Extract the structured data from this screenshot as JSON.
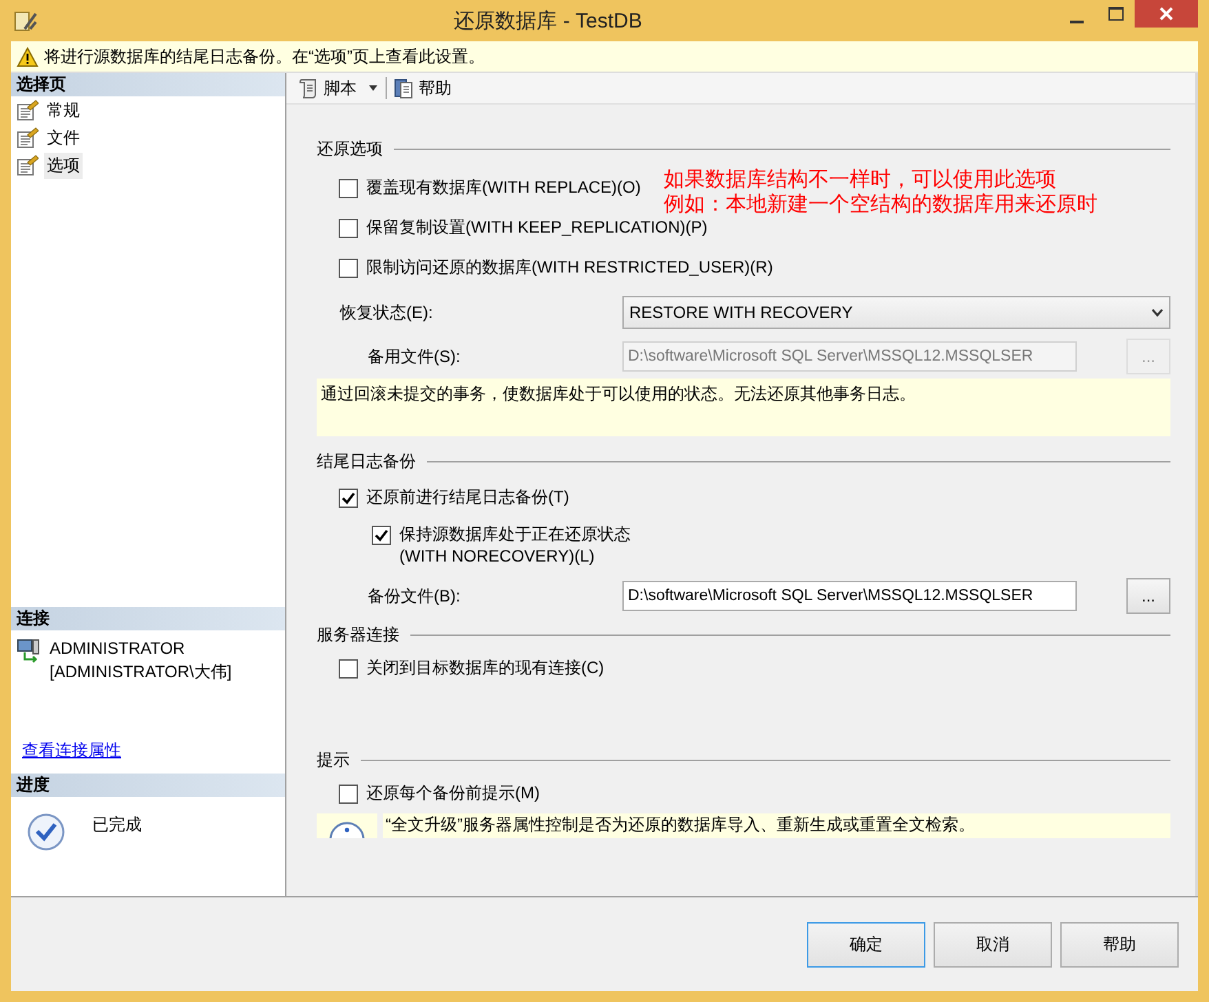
{
  "window": {
    "title": "还原数据库 - TestDB"
  },
  "warning": "将进行源数据库的结尾日志备份。在“选项”页上查看此设置。",
  "sidebar": {
    "pages_header": "选择页",
    "pages": [
      {
        "label": "常规",
        "selected": false
      },
      {
        "label": "文件",
        "selected": false
      },
      {
        "label": "选项",
        "selected": true
      }
    ],
    "connection_header": "连接",
    "connection": [
      "ADMINISTRATOR",
      "[ADMINISTRATOR\\大伟]"
    ],
    "connection_link": "查看连接属性",
    "progress_header": "进度",
    "progress_status": "已完成"
  },
  "toolbar": [
    {
      "label": "脚本",
      "kind": "script",
      "dropdown": true
    },
    {
      "label": "帮助",
      "kind": "help",
      "dropdown": false
    }
  ],
  "restore_options": {
    "title": "还原选项",
    "checkboxes": [
      {
        "label": "覆盖现有数据库(WITH REPLACE)(O)",
        "checked": false
      },
      {
        "label": "保留复制设置(WITH KEEP_REPLICATION)(P)",
        "checked": false
      },
      {
        "label": "限制访问还原的数据库(WITH RESTRICTED_USER)(R)",
        "checked": false
      }
    ],
    "recovery_state": {
      "label": "恢复状态(E):",
      "value": "RESTORE WITH RECOVERY"
    },
    "standby_file": {
      "label": "备用文件(S):",
      "value": "D:\\software\\Microsoft SQL Server\\MSSQL12.MSSQLSER",
      "disabled": true,
      "browse": "..."
    },
    "description": "通过回滚未提交的事务，使数据库处于可以使用的状态。无法还原其他事务日志。"
  },
  "annotation": [
    "如果数据库结构不一样时，可以使用此选项",
    "例如：本地新建一个空结构的数据库用来还原时"
  ],
  "tail_log": {
    "title": "结尾日志备份",
    "checkboxes": [
      {
        "label": "还原前进行结尾日志备份(T)",
        "checked": true,
        "children": [
          {
            "label": "保持源数据库处于正在还原状态\n(WITH NORECOVERY)(L)",
            "checked": true
          }
        ]
      }
    ],
    "backup_file": {
      "label": "备份文件(B):",
      "value": "D:\\software\\Microsoft SQL Server\\MSSQL12.MSSQLSER",
      "disabled": false,
      "browse": "..."
    }
  },
  "server_connection": {
    "title": "服务器连接",
    "checkboxes": [
      {
        "label": "关闭到目标数据库的现有连接(C)",
        "checked": false
      }
    ]
  },
  "prompt": {
    "title": "提示",
    "checkboxes": [
      {
        "label": "还原每个备份前提示(M)",
        "checked": false
      }
    ],
    "info": "“全文升级”服务器属性控制是否为还原的数据库导入、重新生成或重置全文检索。"
  },
  "buttons": [
    {
      "label": "确定",
      "default": true
    },
    {
      "label": "取消",
      "default": false
    },
    {
      "label": "帮助",
      "default": false
    }
  ]
}
